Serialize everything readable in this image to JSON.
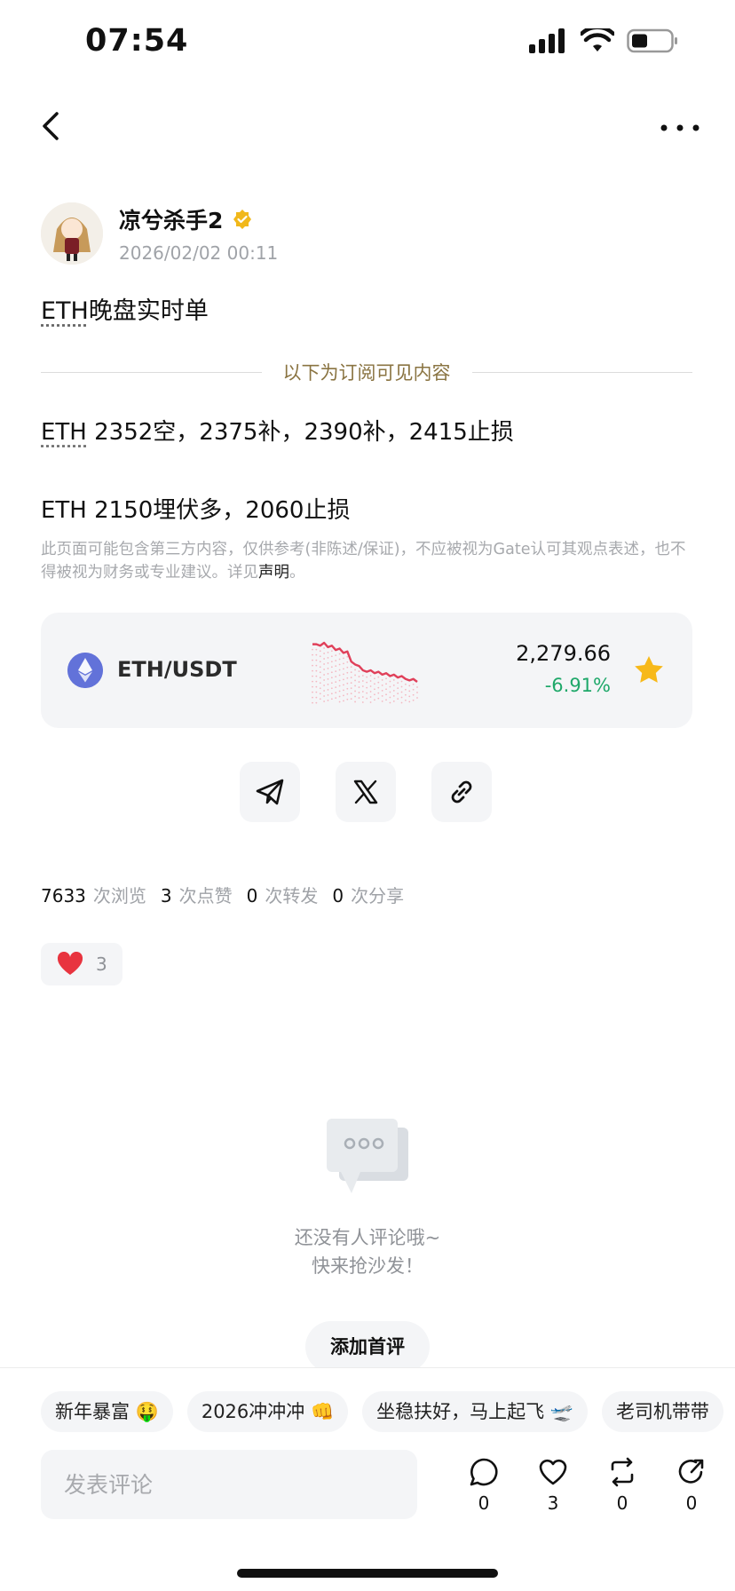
{
  "status_bar": {
    "time": "07:54"
  },
  "post": {
    "author": "凉兮杀手2",
    "time": "2026/02/02 00:11",
    "title_link": "ETH",
    "title_rest": "晚盘实时单",
    "divider_label": "以下为订阅可见内容",
    "line1_link": "ETH",
    "line1_rest": " 2352空，2375补，2390补，2415止损",
    "line2": "ETH 2150埋伏多，2060止损",
    "disclaimer": "此页面可能包含第三方内容，仅供参考(非陈述/保证)，不应被视为Gate认可其观点表述，也不得被视为财务或专业建议。详见",
    "disclaimer_link": "声明",
    "disclaimer_end": "。"
  },
  "ticker": {
    "pair": "ETH/USDT",
    "price": "2,279.66",
    "change": "-6.91%",
    "change_color": "#1ea869",
    "sparkline_values": [
      62,
      62,
      61,
      63,
      60,
      61,
      58,
      59,
      56,
      57,
      50,
      48,
      47,
      44,
      43,
      44,
      42,
      43,
      41,
      42,
      40,
      41,
      39,
      40,
      38,
      37,
      38,
      36
    ]
  },
  "share": {
    "icons": [
      "telegram-icon",
      "x-icon",
      "link-icon"
    ]
  },
  "stats": {
    "views": "7633",
    "views_label": "次浏览",
    "likes": "3",
    "likes_label": "次点赞",
    "reposts": "0",
    "reposts_label": "次转发",
    "shares": "0",
    "shares_label": "次分享"
  },
  "reaction": {
    "emoji": "heart-icon",
    "count": "3"
  },
  "empty_state": {
    "line1": "还没有人评论哦~",
    "line2": "快来抢沙发！",
    "button": "添加首评"
  },
  "tags": [
    "新年暴富 🤑",
    "2026冲冲冲 👊",
    "坐稳扶好，马上起飞 🛫",
    "老司机带带"
  ],
  "comment_box": {
    "placeholder": "发表评论"
  },
  "actions": [
    {
      "icon": "comment-icon",
      "count": "0"
    },
    {
      "icon": "like-icon",
      "count": "3"
    },
    {
      "icon": "repost-icon",
      "count": "0"
    },
    {
      "icon": "share-icon",
      "count": "0"
    }
  ]
}
